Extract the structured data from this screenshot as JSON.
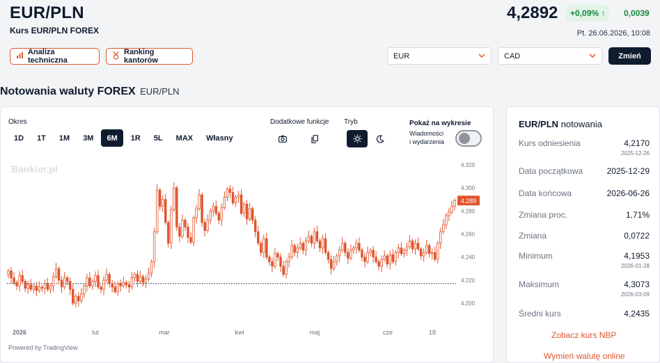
{
  "header": {
    "title": "EUR/PLN",
    "subtitle": "Kurs EUR/PLN FOREX",
    "price": "4,2892",
    "change_pct": "+0,09% ↑",
    "change_abs": "0,0039",
    "datetime": "Pt. 26.06.2026, 10:08",
    "tech_button": "Analiza techniczna",
    "ranking_button": "Ranking kantorów",
    "select_from": "EUR",
    "select_to": "CAD",
    "change_button": "Zmień"
  },
  "section": {
    "title": "Notowania waluty FOREX",
    "subtitle": "EUR/PLN"
  },
  "controls": {
    "period_label": "Okres",
    "periods": [
      "1D",
      "1T",
      "1M",
      "3M",
      "6M",
      "1R",
      "5L",
      "MAX",
      "Własny"
    ],
    "active_period": "6M",
    "extra_label": "Dodatkowe funkcje",
    "mode_label": "Tryb",
    "show_label": "Pokaż na wykresie",
    "news_label_1": "Wiadomości",
    "news_label_2": "i wydarzenia",
    "news_enabled": false
  },
  "chart_data": {
    "type": "candlestick",
    "watermark": "Bankier.pl",
    "x_ticks": [
      "2026",
      "lut",
      "mar",
      "kwi",
      "maj",
      "cze",
      "18"
    ],
    "y_ticks": [
      4.2,
      4.22,
      4.24,
      4.26,
      4.28,
      4.3,
      4.32
    ],
    "ylim": [
      4.19,
      4.325
    ],
    "baseline": 4.217,
    "last_price": 4.289,
    "last_label": "4.289",
    "credit": "Powered by TradingView",
    "colors": {
      "candle": "#e0552c",
      "baseline": "#0f1b2e"
    },
    "close": [
      4.228,
      4.222,
      4.218,
      4.215,
      4.224,
      4.219,
      4.213,
      4.216,
      4.212,
      4.215,
      4.211,
      4.214,
      4.213,
      4.217,
      4.212,
      4.215,
      4.223,
      4.23,
      4.22,
      4.214,
      4.222,
      4.219,
      4.212,
      4.2,
      4.206,
      4.202,
      4.208,
      4.215,
      4.222,
      4.215,
      4.219,
      4.224,
      4.214,
      4.212,
      4.22,
      4.225,
      4.217,
      4.214,
      4.21,
      4.217,
      4.215,
      4.218,
      4.216,
      4.214,
      4.222,
      4.225,
      4.219,
      4.223,
      4.218,
      4.221,
      4.226,
      4.236,
      4.262,
      4.298,
      4.284,
      4.29,
      4.27,
      4.252,
      4.281,
      4.3,
      4.266,
      4.258,
      4.272,
      4.266,
      4.257,
      4.253,
      4.274,
      4.282,
      4.294,
      4.27,
      4.263,
      4.272,
      4.28,
      4.284,
      4.278,
      4.272,
      4.283,
      4.292,
      4.299,
      4.296,
      4.287,
      4.292,
      4.294,
      4.278,
      4.286,
      4.273,
      4.282,
      4.272,
      4.262,
      4.252,
      4.244,
      4.256,
      4.24,
      4.236,
      4.232,
      4.243,
      4.24,
      4.232,
      4.225,
      4.236,
      4.24,
      4.25,
      4.244,
      4.248,
      4.252,
      4.246,
      4.254,
      4.258,
      4.252,
      4.262,
      4.254,
      4.248,
      4.256,
      4.244,
      4.238,
      4.23,
      4.236,
      4.241,
      4.246,
      4.252,
      4.244,
      4.239,
      4.246,
      4.248,
      4.252,
      4.246,
      4.24,
      4.236,
      4.244,
      4.246,
      4.24,
      4.236,
      4.232,
      4.238,
      4.241,
      4.234,
      4.242,
      4.236,
      4.244,
      4.248,
      4.243,
      4.246,
      4.249,
      4.254,
      4.247,
      4.252,
      4.247,
      4.241,
      4.244,
      4.25,
      4.243,
      4.244,
      4.238,
      4.252,
      4.262,
      4.268,
      4.276,
      4.279,
      4.284,
      4.289
    ]
  },
  "info": {
    "title": "EUR/PLN",
    "title_suffix": "notowania",
    "rows": [
      {
        "label": "Kurs odniesienia",
        "value": "4,2170",
        "date": "2025-12-26"
      },
      {
        "label": "Data początkowa",
        "value": "2025-12-29"
      },
      {
        "label": "Data końcowa",
        "value": "2026-06-26"
      },
      {
        "label": "Zmiana proc.",
        "value": "1,71%"
      },
      {
        "label": "Zmiana",
        "value": "0,0722"
      },
      {
        "label": "Minimum",
        "value": "4,1953",
        "date": "2026-01-28"
      },
      {
        "label": "Maksimum",
        "value": "4,3073",
        "date": "2026-03-09"
      },
      {
        "label": "Średni kurs",
        "value": "4,2435"
      }
    ],
    "link_nbp": "Zobacz kurs NBP",
    "link_exchange": "Wymień walutę online"
  }
}
